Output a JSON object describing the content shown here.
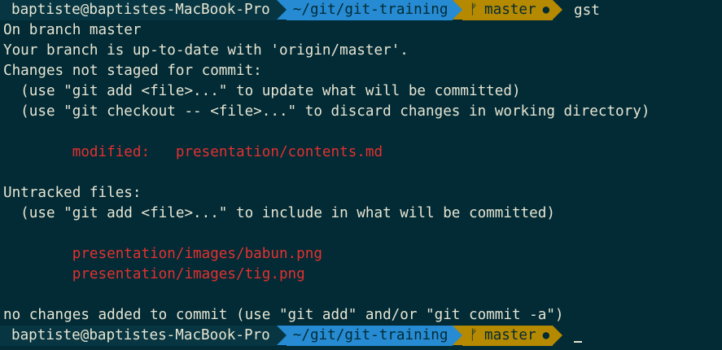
{
  "prompt": {
    "user_host": "baptiste@baptistes-MacBook-Pro",
    "directory": "~/git/git-training",
    "branch_icon": "ᚠ",
    "branch": "master",
    "dirty_indicator": "●"
  },
  "command": "gst",
  "output": {
    "on_branch": "On branch master",
    "up_to_date": "Your branch is up-to-date with 'origin/master'.",
    "changes_header": "Changes not staged for commit:",
    "hint_add": "  (use \"git add <file>...\" to update what will be committed)",
    "hint_checkout": "  (use \"git checkout -- <file>...\" to discard changes in working directory)",
    "modified_label": "        modified:   ",
    "modified_file": "presentation/contents.md",
    "untracked_header": "Untracked files:",
    "hint_untracked": "  (use \"git add <file>...\" to include in what will be committed)",
    "untracked_files": [
      "        presentation/images/babun.png",
      "        presentation/images/tig.png"
    ],
    "summary": "no changes added to commit (use \"git add\" and/or \"git commit -a\")"
  },
  "colors": {
    "background": "#022b36",
    "foreground": "#e7e5d2",
    "red": "#e5302e",
    "segment_user": "#073642",
    "segment_dir": "#268bd2",
    "segment_git": "#b58900"
  }
}
